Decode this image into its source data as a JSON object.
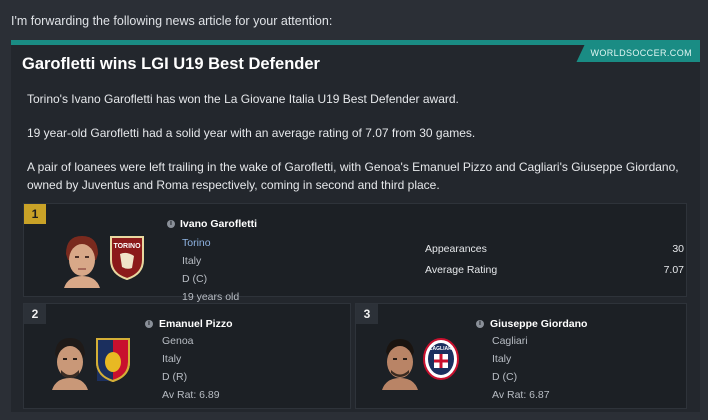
{
  "intro": "I'm forwarding the following news article for your attention:",
  "article": {
    "source": "WORLDSOCCER.COM",
    "headline": "Garofletti wins LGI U19 Best Defender",
    "paragraphs": [
      "Torino's Ivano Garofletti has won the La Giovane Italia U19 Best Defender award.",
      "19 year-old Garofletti had a solid year with an average rating of 7.07 from 30 games.",
      "A pair of loanees were left trailing in the wake of Garofletti, with Genoa's Emanuel Pizzo and Cagliari's Giuseppe Giordano, owned by Juventus and Roma respectively, coming in second and third place."
    ]
  },
  "winners": [
    {
      "rank": "1",
      "name": "Ivano Garofletti",
      "club": "Torino",
      "nation": "Italy",
      "position": "D (C)",
      "age": "19 years old",
      "stats": [
        {
          "label": "Appearances",
          "value": "30"
        },
        {
          "label": "Average Rating",
          "value": "7.07"
        }
      ]
    },
    {
      "rank": "2",
      "name": "Emanuel Pizzo",
      "club": "Genoa",
      "nation": "Italy",
      "position": "D (R)",
      "rating": "Av Rat: 6.89"
    },
    {
      "rank": "3",
      "name": "Giuseppe Giordano",
      "club": "Cagliari",
      "nation": "Italy",
      "position": "D (C)",
      "rating": "Av Rat: 6.87"
    }
  ],
  "crest_text": {
    "torino": "TORINO",
    "cagliari": "CAGLIARI"
  },
  "colors": {
    "accent_teal": "#1a8c84",
    "rank_gold": "#c9a227",
    "club_link": "#8fb4e3"
  }
}
